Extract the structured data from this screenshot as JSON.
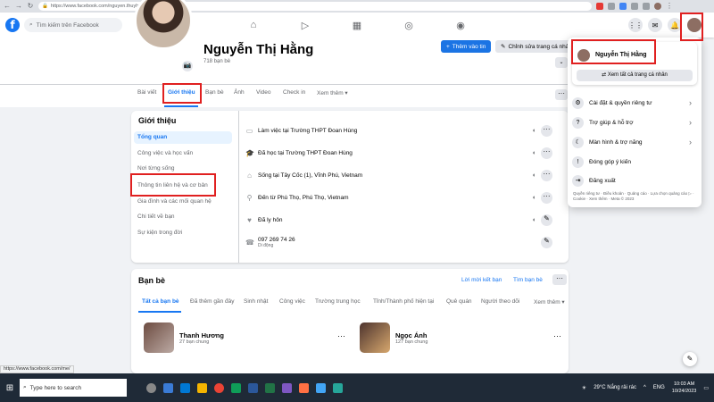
{
  "browser": {
    "url": "https://www.facebook.com/nguyen.thuyhang.73345048/about"
  },
  "topbar": {
    "search_placeholder": "Tìm kiếm trên Facebook"
  },
  "profile": {
    "name": "Nguyễn Thị Hằng",
    "friends_count": "718 bạn bè",
    "add_story_label": "Thêm vào tin",
    "edit_profile_label": "Chỉnh sửa trang cá nhân",
    "tabs": [
      "Bài viết",
      "Giới thiệu",
      "Bạn bè",
      "Ảnh",
      "Video",
      "Check in",
      "Xem thêm"
    ]
  },
  "about": {
    "title": "Giới thiệu",
    "sections": [
      "Tổng quan",
      "Công việc và học vấn",
      "Nơi từng sống",
      "Thông tin liên hệ và cơ bản",
      "Gia đình và các mối quan hệ",
      "Chi tiết về bạn",
      "Sự kiện trong đời"
    ],
    "details": [
      {
        "icon": "briefcase-icon",
        "text": "Làm việc tại Trường THPT Đoan Hùng"
      },
      {
        "icon": "graduation-cap-icon",
        "text": "Đã học tại Trường THPT Đoan Hùng"
      },
      {
        "icon": "home-icon",
        "text": "Sống tại Tây Cốc (1), Vĩnh Phú, Vietnam"
      },
      {
        "icon": "location-pin-icon",
        "text": "Đến từ Phù Thọ, Phú Thọ, Vietnam"
      },
      {
        "icon": "heart-icon",
        "text": "Đã ly hôn"
      },
      {
        "icon": "phone-icon",
        "text": "097 269 74 26",
        "sub": "Di động"
      }
    ]
  },
  "friends": {
    "title": "Bạn bè",
    "requests_label": "Lời mời kết bạn",
    "find_label": "Tìm bạn bè",
    "tabs": [
      "Tất cả bạn bè",
      "Đã thêm gần đây",
      "Sinh nhật",
      "Công việc",
      "Trường trung học",
      "Tỉnh/Thành phố hiện tại",
      "Quê quán",
      "Người theo dõi",
      "Xem thêm"
    ],
    "list": [
      {
        "name": "Thanh Hương",
        "mutual": "27 bạn chung"
      },
      {
        "name": "Ngọc Ánh",
        "mutual": "127 bạn chung"
      }
    ]
  },
  "dropdown": {
    "profile_name": "Nguyễn Thị Hằng",
    "see_all_label": "Xem tất cả trang cá nhân",
    "items": [
      {
        "icon": "gear-icon",
        "label": "Cài đặt & quyền riêng tư",
        "chevron": true
      },
      {
        "icon": "help-icon",
        "label": "Trợ giúp & hỗ trợ",
        "chevron": true
      },
      {
        "icon": "moon-icon",
        "label": "Màn hình & trợ năng",
        "chevron": true
      },
      {
        "icon": "feedback-icon",
        "label": "Đóng góp ý kiến",
        "chevron": false
      },
      {
        "icon": "logout-icon",
        "label": "Đăng xuất",
        "chevron": false
      }
    ],
    "footer": "Quyền riêng tư · Điều khoản · Quảng cáo · Lựa chọn quảng cáo ▷ · Cookie · Xem thêm · Meta © 2023"
  },
  "status_url": "https://www.facebook.com/me/",
  "taskbar": {
    "search_placeholder": "Type here to search",
    "weather": "29°C Nắng rải rác",
    "language": "ENG",
    "time": "10:03 AM",
    "date": "10/24/2023"
  }
}
